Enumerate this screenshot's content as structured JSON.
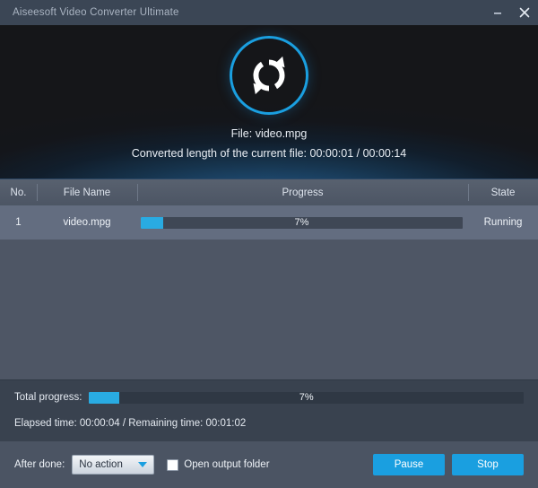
{
  "window": {
    "title": "Aiseesoft Video Converter Ultimate",
    "controls": [
      {
        "name": "minimize",
        "glyph": "minimize-icon"
      },
      {
        "name": "close",
        "glyph": "close-icon"
      }
    ]
  },
  "hero": {
    "logo_icon": "convert-refresh-icon",
    "file_line": "File: video.mpg",
    "converted_line": "Converted length of the current file: 00:00:01 / 00:00:14"
  },
  "table": {
    "columns": [
      {
        "key": "no",
        "label": "No."
      },
      {
        "key": "file_name",
        "label": "File Name"
      },
      {
        "key": "progress",
        "label": "Progress"
      },
      {
        "key": "state",
        "label": "State"
      }
    ],
    "rows": [
      {
        "no": "1",
        "file_name": "video.mpg",
        "progress_label": "7%",
        "progress_percent": 7,
        "state": "Running"
      }
    ]
  },
  "totals": {
    "label": "Total progress:",
    "percent_label": "7%",
    "percent": 7,
    "time_line": "Elapsed time: 00:00:04 / Remaining time: 00:01:02"
  },
  "footer": {
    "after_done_label": "After done:",
    "after_done_value": "No action",
    "after_done_options": [
      "No action"
    ],
    "open_output_folder_label": "Open output folder",
    "open_output_folder_checked": false,
    "pause_label": "Pause",
    "stop_label": "Stop"
  },
  "colors": {
    "accent": "#29abe2",
    "button": "#1a9fe0",
    "titlebar": "#3b4655",
    "list_bg": "#4e5665",
    "row_bg": "#636d80",
    "totals_bg": "#39424f",
    "footer_bg": "#4b5463"
  }
}
